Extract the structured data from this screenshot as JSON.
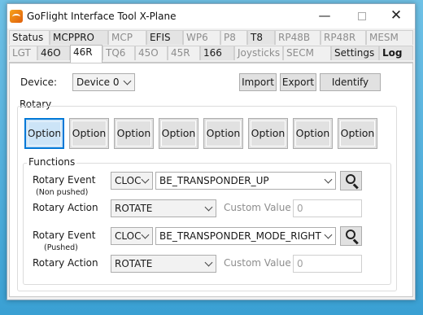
{
  "window": {
    "title": "GoFlight Interface Tool X-Plane"
  },
  "tabs_row1": [
    {
      "label": "Status",
      "state": "normal"
    },
    {
      "label": "MCPPRO",
      "state": "highlighted"
    },
    {
      "label": "MCP",
      "state": "disabled"
    },
    {
      "label": "EFIS",
      "state": "highlighted"
    },
    {
      "label": "WP6",
      "state": "disabled"
    },
    {
      "label": "P8",
      "state": "disabled"
    },
    {
      "label": "T8",
      "state": "highlighted"
    },
    {
      "label": "RP48B",
      "state": "disabled"
    },
    {
      "label": "RP48R",
      "state": "disabled"
    },
    {
      "label": "MESM",
      "state": "disabled"
    }
  ],
  "tabs_row2": [
    {
      "label": "LGT",
      "state": "disabled"
    },
    {
      "label": "46O",
      "state": "highlighted"
    },
    {
      "label": "46R",
      "state": "active"
    },
    {
      "label": "TQ6",
      "state": "disabled"
    },
    {
      "label": "45O",
      "state": "disabled"
    },
    {
      "label": "45R",
      "state": "disabled"
    },
    {
      "label": "166",
      "state": "highlighted"
    },
    {
      "label": "Joysticks",
      "state": "disabled"
    },
    {
      "label": "SECM",
      "state": "disabled"
    },
    {
      "label": "Settings",
      "state": "highlighted"
    },
    {
      "label": "Log",
      "state": "bold"
    }
  ],
  "device": {
    "label": "Device:",
    "value": "Device 0"
  },
  "toolbar": {
    "import": "Import",
    "export": "Export",
    "identify": "Identify"
  },
  "rotary": {
    "title": "Rotary",
    "options": [
      "Option",
      "Option",
      "Option",
      "Option",
      "Option",
      "Option",
      "Option",
      "Option"
    ],
    "selected_index": 0
  },
  "functions": {
    "title": "Functions",
    "nonpushed": {
      "event_label": "Rotary Event",
      "event_sub": "(Non pushed)",
      "direction": "CLOC",
      "command": "BE_TRANSPONDER_UP",
      "action_label": "Rotary Action",
      "action": "ROTATE",
      "custom_label": "Custom Value",
      "custom_value": "0"
    },
    "pushed": {
      "event_label": "Rotary Event",
      "event_sub": "(Pushed)",
      "direction": "CLOC",
      "command": "BE_TRANSPONDER_MODE_RIGHT",
      "action_label": "Rotary Action",
      "action": "ROTATE",
      "custom_label": "Custom Value",
      "custom_value": "0"
    }
  },
  "colors": {
    "accent": "#0078d7",
    "selected_fill": "#cce4f7",
    "desktop": "#3aa0d3"
  },
  "icons": [
    "app-icon",
    "minimize-icon",
    "maximize-icon",
    "close-icon",
    "search-icon",
    "chevron-down-icon"
  ]
}
